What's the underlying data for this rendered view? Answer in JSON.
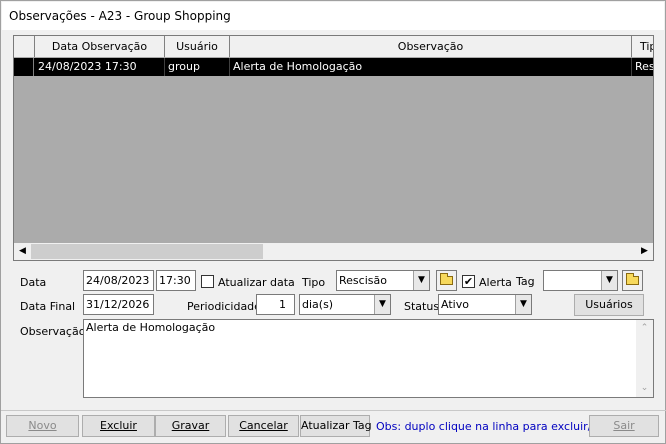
{
  "window": {
    "title": "Observações - A23 - Group Shopping"
  },
  "grid": {
    "columns": [
      "Data Observação",
      "Usuário",
      "Observação",
      "Tip"
    ],
    "rows": [
      {
        "data": "24/08/2023 17:30",
        "usuario": "group",
        "observacao": "Alerta de Homologação",
        "tipo": "Res"
      }
    ]
  },
  "form": {
    "data_label": "Data",
    "data_value": "24/08/2023",
    "hora_value": "17:30",
    "atualizar_data_label": "Atualizar data",
    "atualizar_data_checked": false,
    "tipo_label": "Tipo",
    "tipo_value": "Rescisão",
    "alerta_label": "Alerta",
    "alerta_checked": true,
    "alerta_mark": "✔",
    "tag_label": "Tag",
    "tag_value": "",
    "data_final_label": "Data Final",
    "data_final_value": "31/12/2026",
    "periodicidade_label": "Periodicidade",
    "periodicidade_value": "1",
    "periodo_unit": "dia(s)",
    "status_label": "Status",
    "status_value": "Ativo",
    "usuarios_button": "Usuários",
    "observacao_label": "Observação",
    "observacao_value": "Alerta de Homologação"
  },
  "footer": {
    "novo": "Novo",
    "excluir": "Excluir",
    "gravar": "Gravar",
    "cancelar": "Cancelar",
    "atualizar_tag": "Atualizar Tag",
    "hint": "Obs: duplo clique na linha para excluir/editar",
    "sair": "Sair"
  }
}
